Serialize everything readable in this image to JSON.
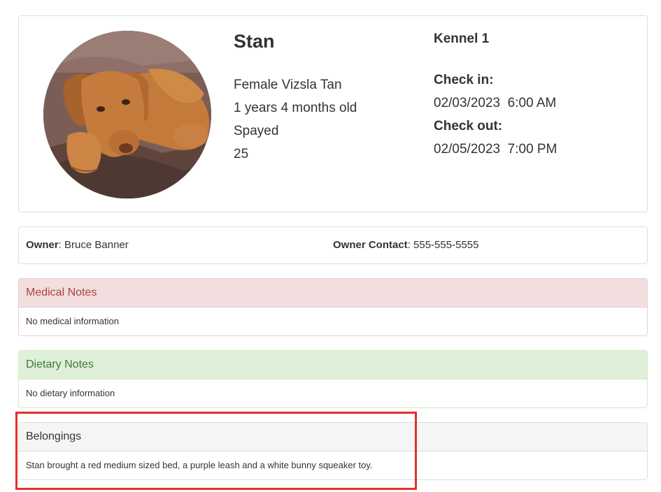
{
  "pet": {
    "name": "Stan",
    "description": "Female Vizsla Tan",
    "age": "1 years 4 months old",
    "status": "Spayed",
    "weight": "25",
    "photo_icon": "dog-photo"
  },
  "stay": {
    "kennel": "Kennel 1",
    "check_in_label": "Check in:",
    "check_in_value": "02/03/2023  6:00 AM",
    "check_out_label": "Check out:",
    "check_out_value": "02/05/2023  7:00 PM"
  },
  "owner": {
    "name_label": "Owner",
    "name_value": ": Bruce Banner",
    "contact_label": "Owner Contact",
    "contact_value": ": 555-555-5555"
  },
  "medical": {
    "heading": "Medical Notes",
    "body": "No medical information"
  },
  "dietary": {
    "heading": "Dietary Notes",
    "body": "No dietary information"
  },
  "belongings": {
    "heading": "Belongings",
    "body": "Stan brought a red medium sized bed, a purple leash and a white bunny squeaker toy."
  },
  "colors": {
    "medical_bg": "#f2dede",
    "medical_text": "#a94442",
    "dietary_bg": "#dff0d8",
    "dietary_text": "#3c763d",
    "highlight": "#e3302a"
  }
}
